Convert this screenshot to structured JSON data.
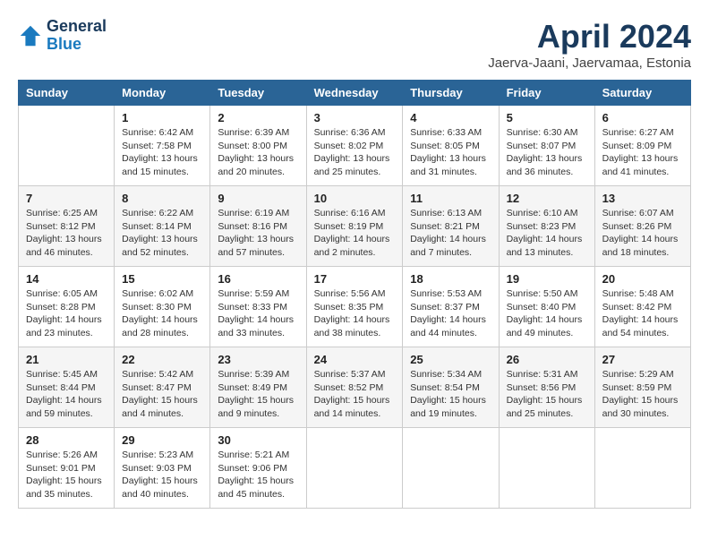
{
  "header": {
    "logo_general": "General",
    "logo_blue": "Blue",
    "month": "April 2024",
    "location": "Jaerva-Jaani, Jaervamaa, Estonia"
  },
  "calendar": {
    "days_of_week": [
      "Sunday",
      "Monday",
      "Tuesday",
      "Wednesday",
      "Thursday",
      "Friday",
      "Saturday"
    ],
    "weeks": [
      [
        {
          "day": "",
          "info": ""
        },
        {
          "day": "1",
          "info": "Sunrise: 6:42 AM\nSunset: 7:58 PM\nDaylight: 13 hours\nand 15 minutes."
        },
        {
          "day": "2",
          "info": "Sunrise: 6:39 AM\nSunset: 8:00 PM\nDaylight: 13 hours\nand 20 minutes."
        },
        {
          "day": "3",
          "info": "Sunrise: 6:36 AM\nSunset: 8:02 PM\nDaylight: 13 hours\nand 25 minutes."
        },
        {
          "day": "4",
          "info": "Sunrise: 6:33 AM\nSunset: 8:05 PM\nDaylight: 13 hours\nand 31 minutes."
        },
        {
          "day": "5",
          "info": "Sunrise: 6:30 AM\nSunset: 8:07 PM\nDaylight: 13 hours\nand 36 minutes."
        },
        {
          "day": "6",
          "info": "Sunrise: 6:27 AM\nSunset: 8:09 PM\nDaylight: 13 hours\nand 41 minutes."
        }
      ],
      [
        {
          "day": "7",
          "info": "Sunrise: 6:25 AM\nSunset: 8:12 PM\nDaylight: 13 hours\nand 46 minutes."
        },
        {
          "day": "8",
          "info": "Sunrise: 6:22 AM\nSunset: 8:14 PM\nDaylight: 13 hours\nand 52 minutes."
        },
        {
          "day": "9",
          "info": "Sunrise: 6:19 AM\nSunset: 8:16 PM\nDaylight: 13 hours\nand 57 minutes."
        },
        {
          "day": "10",
          "info": "Sunrise: 6:16 AM\nSunset: 8:19 PM\nDaylight: 14 hours\nand 2 minutes."
        },
        {
          "day": "11",
          "info": "Sunrise: 6:13 AM\nSunset: 8:21 PM\nDaylight: 14 hours\nand 7 minutes."
        },
        {
          "day": "12",
          "info": "Sunrise: 6:10 AM\nSunset: 8:23 PM\nDaylight: 14 hours\nand 13 minutes."
        },
        {
          "day": "13",
          "info": "Sunrise: 6:07 AM\nSunset: 8:26 PM\nDaylight: 14 hours\nand 18 minutes."
        }
      ],
      [
        {
          "day": "14",
          "info": "Sunrise: 6:05 AM\nSunset: 8:28 PM\nDaylight: 14 hours\nand 23 minutes."
        },
        {
          "day": "15",
          "info": "Sunrise: 6:02 AM\nSunset: 8:30 PM\nDaylight: 14 hours\nand 28 minutes."
        },
        {
          "day": "16",
          "info": "Sunrise: 5:59 AM\nSunset: 8:33 PM\nDaylight: 14 hours\nand 33 minutes."
        },
        {
          "day": "17",
          "info": "Sunrise: 5:56 AM\nSunset: 8:35 PM\nDaylight: 14 hours\nand 38 minutes."
        },
        {
          "day": "18",
          "info": "Sunrise: 5:53 AM\nSunset: 8:37 PM\nDaylight: 14 hours\nand 44 minutes."
        },
        {
          "day": "19",
          "info": "Sunrise: 5:50 AM\nSunset: 8:40 PM\nDaylight: 14 hours\nand 49 minutes."
        },
        {
          "day": "20",
          "info": "Sunrise: 5:48 AM\nSunset: 8:42 PM\nDaylight: 14 hours\nand 54 minutes."
        }
      ],
      [
        {
          "day": "21",
          "info": "Sunrise: 5:45 AM\nSunset: 8:44 PM\nDaylight: 14 hours\nand 59 minutes."
        },
        {
          "day": "22",
          "info": "Sunrise: 5:42 AM\nSunset: 8:47 PM\nDaylight: 15 hours\nand 4 minutes."
        },
        {
          "day": "23",
          "info": "Sunrise: 5:39 AM\nSunset: 8:49 PM\nDaylight: 15 hours\nand 9 minutes."
        },
        {
          "day": "24",
          "info": "Sunrise: 5:37 AM\nSunset: 8:52 PM\nDaylight: 15 hours\nand 14 minutes."
        },
        {
          "day": "25",
          "info": "Sunrise: 5:34 AM\nSunset: 8:54 PM\nDaylight: 15 hours\nand 19 minutes."
        },
        {
          "day": "26",
          "info": "Sunrise: 5:31 AM\nSunset: 8:56 PM\nDaylight: 15 hours\nand 25 minutes."
        },
        {
          "day": "27",
          "info": "Sunrise: 5:29 AM\nSunset: 8:59 PM\nDaylight: 15 hours\nand 30 minutes."
        }
      ],
      [
        {
          "day": "28",
          "info": "Sunrise: 5:26 AM\nSunset: 9:01 PM\nDaylight: 15 hours\nand 35 minutes."
        },
        {
          "day": "29",
          "info": "Sunrise: 5:23 AM\nSunset: 9:03 PM\nDaylight: 15 hours\nand 40 minutes."
        },
        {
          "day": "30",
          "info": "Sunrise: 5:21 AM\nSunset: 9:06 PM\nDaylight: 15 hours\nand 45 minutes."
        },
        {
          "day": "",
          "info": ""
        },
        {
          "day": "",
          "info": ""
        },
        {
          "day": "",
          "info": ""
        },
        {
          "day": "",
          "info": ""
        }
      ]
    ]
  }
}
